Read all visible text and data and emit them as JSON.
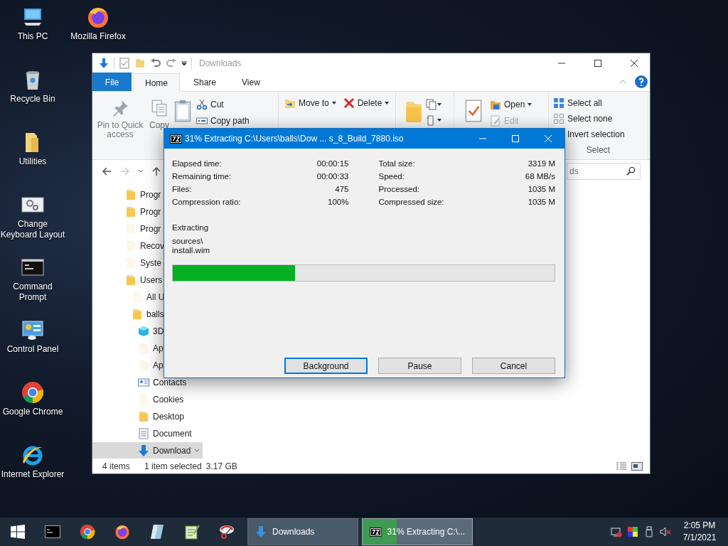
{
  "desktop_icons": [
    {
      "label": "This PC",
      "kind": "pc"
    },
    {
      "label": "Recycle Bin",
      "kind": "bin"
    },
    {
      "label": "Utilities",
      "kind": "folder"
    },
    {
      "label": "Change Keyboard Layout",
      "kind": "settings"
    },
    {
      "label": "Command Prompt",
      "kind": "terminal"
    },
    {
      "label": "Control Panel",
      "kind": "panel"
    },
    {
      "label": "Google Chrome",
      "kind": "chrome"
    },
    {
      "label": "Internet Explorer",
      "kind": "ie"
    }
  ],
  "desktop_icons_column_2": [
    {
      "label": "Mozilla Firefox",
      "kind": "firefox"
    }
  ],
  "explorer": {
    "title": "Downloads",
    "tabs": [
      {
        "label": "File",
        "kind": "file",
        "selected": false
      },
      {
        "label": "Home",
        "kind": "tab",
        "selected": true
      },
      {
        "label": "Share",
        "kind": "tab",
        "selected": false
      },
      {
        "label": "View",
        "kind": "tab",
        "selected": false
      }
    ],
    "ribbon": {
      "pin": "Pin to Quick access",
      "copy": "Copy",
      "cut": "Cut",
      "copy_path": "Copy path",
      "move_to": "Move to",
      "delete": "Delete",
      "open": "Open",
      "edit": {
        "label": "Edit",
        "disabled": true
      },
      "select_all": "Select all",
      "select_none": "Select none",
      "invert_selection": "Invert selection",
      "select_group": "Select"
    },
    "search": {
      "placeholder": "ds"
    },
    "nav_items": [
      {
        "label": "Progr",
        "kind": "folder",
        "hidden": false,
        "selected": false
      },
      {
        "label": "Progr",
        "kind": "folder",
        "hidden": false,
        "selected": false
      },
      {
        "label": "Progr",
        "kind": "folder",
        "hidden": true,
        "selected": false
      },
      {
        "label": "Recov",
        "kind": "folder",
        "hidden": true,
        "selected": false
      },
      {
        "label": "Syste",
        "kind": "folder",
        "hidden": true,
        "selected": false
      },
      {
        "label": "Users",
        "kind": "folder",
        "hidden": false,
        "selected": false,
        "children": [
          {
            "label": "All U",
            "kind": "folder",
            "hidden": true,
            "selected": false
          },
          {
            "label": "balls",
            "kind": "folder",
            "hidden": false,
            "selected": false,
            "children": [
              {
                "label": "3D",
                "kind": "cube",
                "hidden": false,
                "selected": false
              },
              {
                "label": "Ap",
                "kind": "folder",
                "hidden": true,
                "selected": false
              },
              {
                "label": "Ap",
                "kind": "folder",
                "hidden": true,
                "selected": false
              },
              {
                "label": "Contacts",
                "kind": "contacts",
                "hidden": false,
                "selected": false
              },
              {
                "label": "Cookies",
                "kind": "folder",
                "hidden": true,
                "selected": false
              },
              {
                "label": "Desktop",
                "kind": "folder",
                "hidden": false,
                "selected": false
              },
              {
                "label": "Document",
                "kind": "document",
                "hidden": false,
                "selected": false
              },
              {
                "label": "Download",
                "kind": "download",
                "hidden": false,
                "selected": true
              }
            ]
          }
        ]
      }
    ],
    "status": {
      "items": "4 items",
      "selected": "1 item selected",
      "size": "3.17 GB"
    }
  },
  "dialog": {
    "title": "31% Extracting C:\\Users\\balls\\Dow ... s_8_Build_7880.iso",
    "stats_left": [
      {
        "label": "Elapsed time:",
        "value": "00:00:15"
      },
      {
        "label": "Remaining time:",
        "value": "00:00:33"
      },
      {
        "label": "Files:",
        "value": "475"
      },
      {
        "label": "Compression ratio:",
        "value": "100%"
      }
    ],
    "stats_right": [
      {
        "label": "Total size:",
        "value": "3319 M"
      },
      {
        "label": "Speed:",
        "value": "68 MB/s"
      },
      {
        "label": "Processed:",
        "value": "1035 M"
      },
      {
        "label": "Compressed size:",
        "value": "1035 M"
      }
    ],
    "status": "Extracting",
    "path_lines": [
      "sources\\",
      "install.wim"
    ],
    "progress": {
      "level": 0.32
    },
    "buttons": [
      {
        "label": "Background",
        "focused": true
      },
      {
        "label": "Pause",
        "focused": false
      },
      {
        "label": "Cancel",
        "focused": false
      }
    ]
  },
  "taskbar": {
    "apps": [
      {
        "kind": "terminal"
      },
      {
        "kind": "chrome"
      },
      {
        "kind": "firefox"
      },
      {
        "kind": "crystal"
      },
      {
        "kind": "notepad"
      },
      {
        "kind": "scissors"
      }
    ],
    "tasks": [
      {
        "label": "Downloads",
        "kind": "folder"
      },
      {
        "label": "31% Extracting C:\\...",
        "kind": "progress",
        "level": 0.31
      }
    ],
    "clock": {
      "time": "2:05 PM",
      "date": "7/1/2021"
    }
  }
}
